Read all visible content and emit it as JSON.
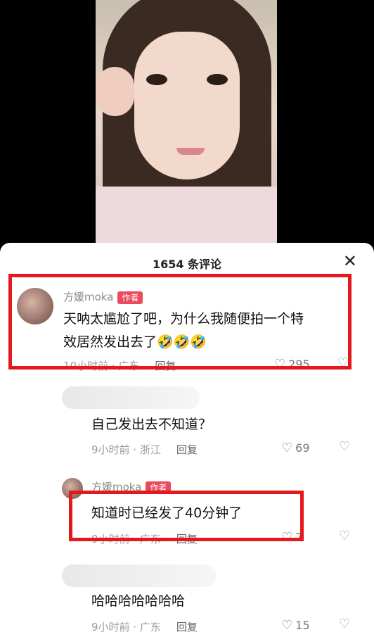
{
  "sheet": {
    "title": "1654 条评论",
    "close_icon": "×"
  },
  "comments": [
    {
      "name": "方媛moka",
      "badge": "作者",
      "text_line1": "天呐太尴尬了吧，为什么我随便拍一个特",
      "text_line2": "效居然发出去了🤣🤣🤣",
      "time": "10小时前 · 广东",
      "reply": "回复",
      "likes": "295"
    },
    {
      "text": "自己发出去不知道？",
      "time": "9小时前 · 浙江",
      "reply": "回复",
      "likes": "69"
    },
    {
      "name": "方媛moka",
      "badge": "作者",
      "text": "知道时已经发了40分钟了",
      "time": "9小时前 · 广东",
      "reply": "回复",
      "likes": "7"
    },
    {
      "text": "哈哈哈哈哈哈哈",
      "time": "9小时前 · 广东",
      "reply": "回复",
      "likes": "15"
    }
  ],
  "icons": {
    "heart": "♡",
    "broken_heart": "💔",
    "close": "✕"
  },
  "colors": {
    "highlight": "#e4181f",
    "badge": "#e94b5d"
  }
}
